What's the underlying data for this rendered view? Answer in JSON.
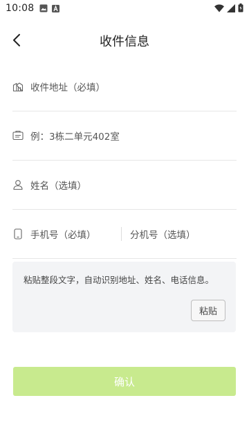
{
  "status_bar": {
    "time": "10:08",
    "icons": [
      "image-icon",
      "a-icon",
      "wifi-icon",
      "signal-icon",
      "battery-icon"
    ]
  },
  "header": {
    "title": "收件信息",
    "back_icon": "chevron-left-icon"
  },
  "form": {
    "address": {
      "placeholder": "收件地址（必填）",
      "icon": "building-icon"
    },
    "detail": {
      "placeholder": "例：3栋二单元402室",
      "icon": "card-icon"
    },
    "name": {
      "placeholder": "姓名（选填）",
      "icon": "person-icon"
    },
    "phone": {
      "placeholder": "手机号（必填）",
      "icon": "phone-icon"
    },
    "extension": {
      "placeholder": "分机号（选填）"
    }
  },
  "paste": {
    "hint": "粘贴整段文字，自动识别地址、姓名、电话信息。",
    "button_label": "粘贴"
  },
  "confirm": {
    "label": "确认",
    "color": "#c8ea8e"
  }
}
